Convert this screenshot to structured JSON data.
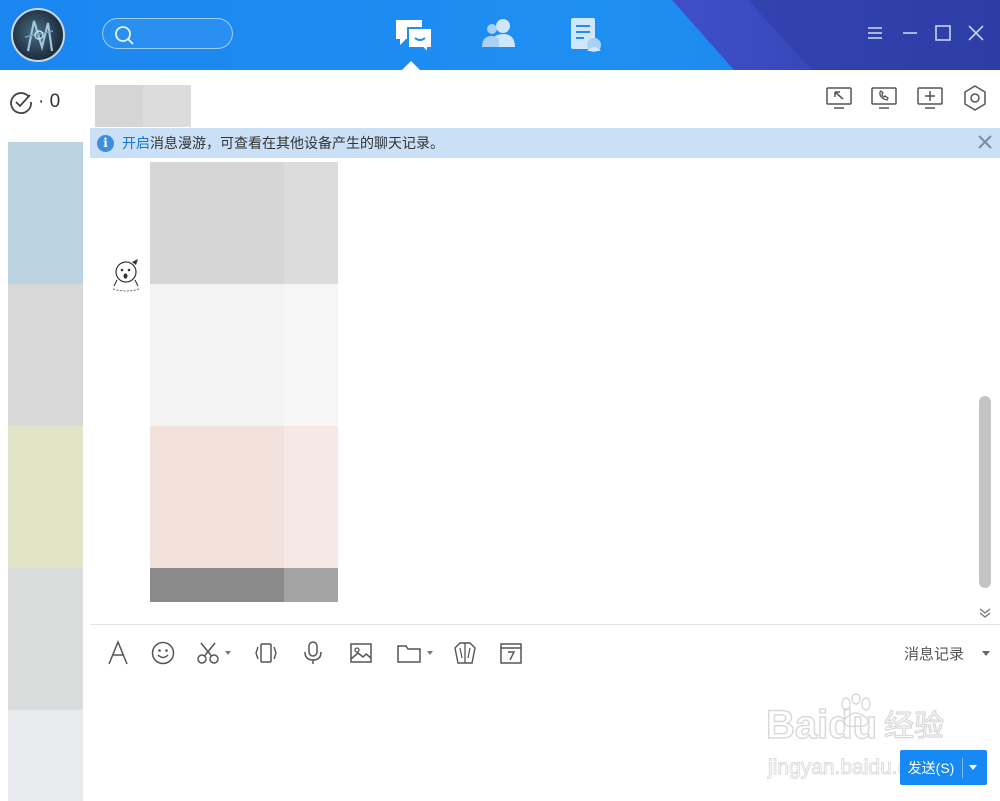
{
  "window": {
    "nav_tabs": [
      {
        "id": "messages",
        "icon": "chat-bubble-icon",
        "active": true
      },
      {
        "id": "contacts",
        "icon": "contacts-icon",
        "active": false
      },
      {
        "id": "space",
        "icon": "document-icon",
        "active": false
      }
    ],
    "controls": [
      "menu-icon",
      "minimize-icon",
      "maximize-icon",
      "close-icon"
    ],
    "colors": {
      "topbar": "#1e8ff2",
      "topbar_dark": "#3646b8",
      "accent": "#1689f5"
    }
  },
  "sidebar": {
    "status_count": "· 0",
    "contacts": [
      {
        "color": "#bcd3e2"
      },
      {
        "color": "#d8d8d8"
      },
      {
        "color": "#e2e4c7"
      },
      {
        "color": "#dadcdc"
      },
      {
        "color": "#e8eaee"
      }
    ]
  },
  "chat": {
    "header_icons": [
      "screen-share-icon",
      "voice-call-icon",
      "add-member-icon",
      "settings-icon"
    ],
    "notice": {
      "link_text": "开启",
      "text": "消息漫游，可查看在其他设备产生的聊天记录。",
      "info_glyph": "i"
    }
  },
  "toolbar": {
    "tools": [
      "font-icon",
      "emoji-icon",
      "screenshot-icon",
      "shake-icon",
      "voice-icon",
      "image-icon",
      "file-icon",
      "gift-icon",
      "calendar-icon"
    ],
    "history_label": "消息记录"
  },
  "send": {
    "label": "发送(S)"
  },
  "watermark": {
    "brand": "Baidu",
    "brand_cn": "经验",
    "url": "jingyan.baidu.com"
  }
}
